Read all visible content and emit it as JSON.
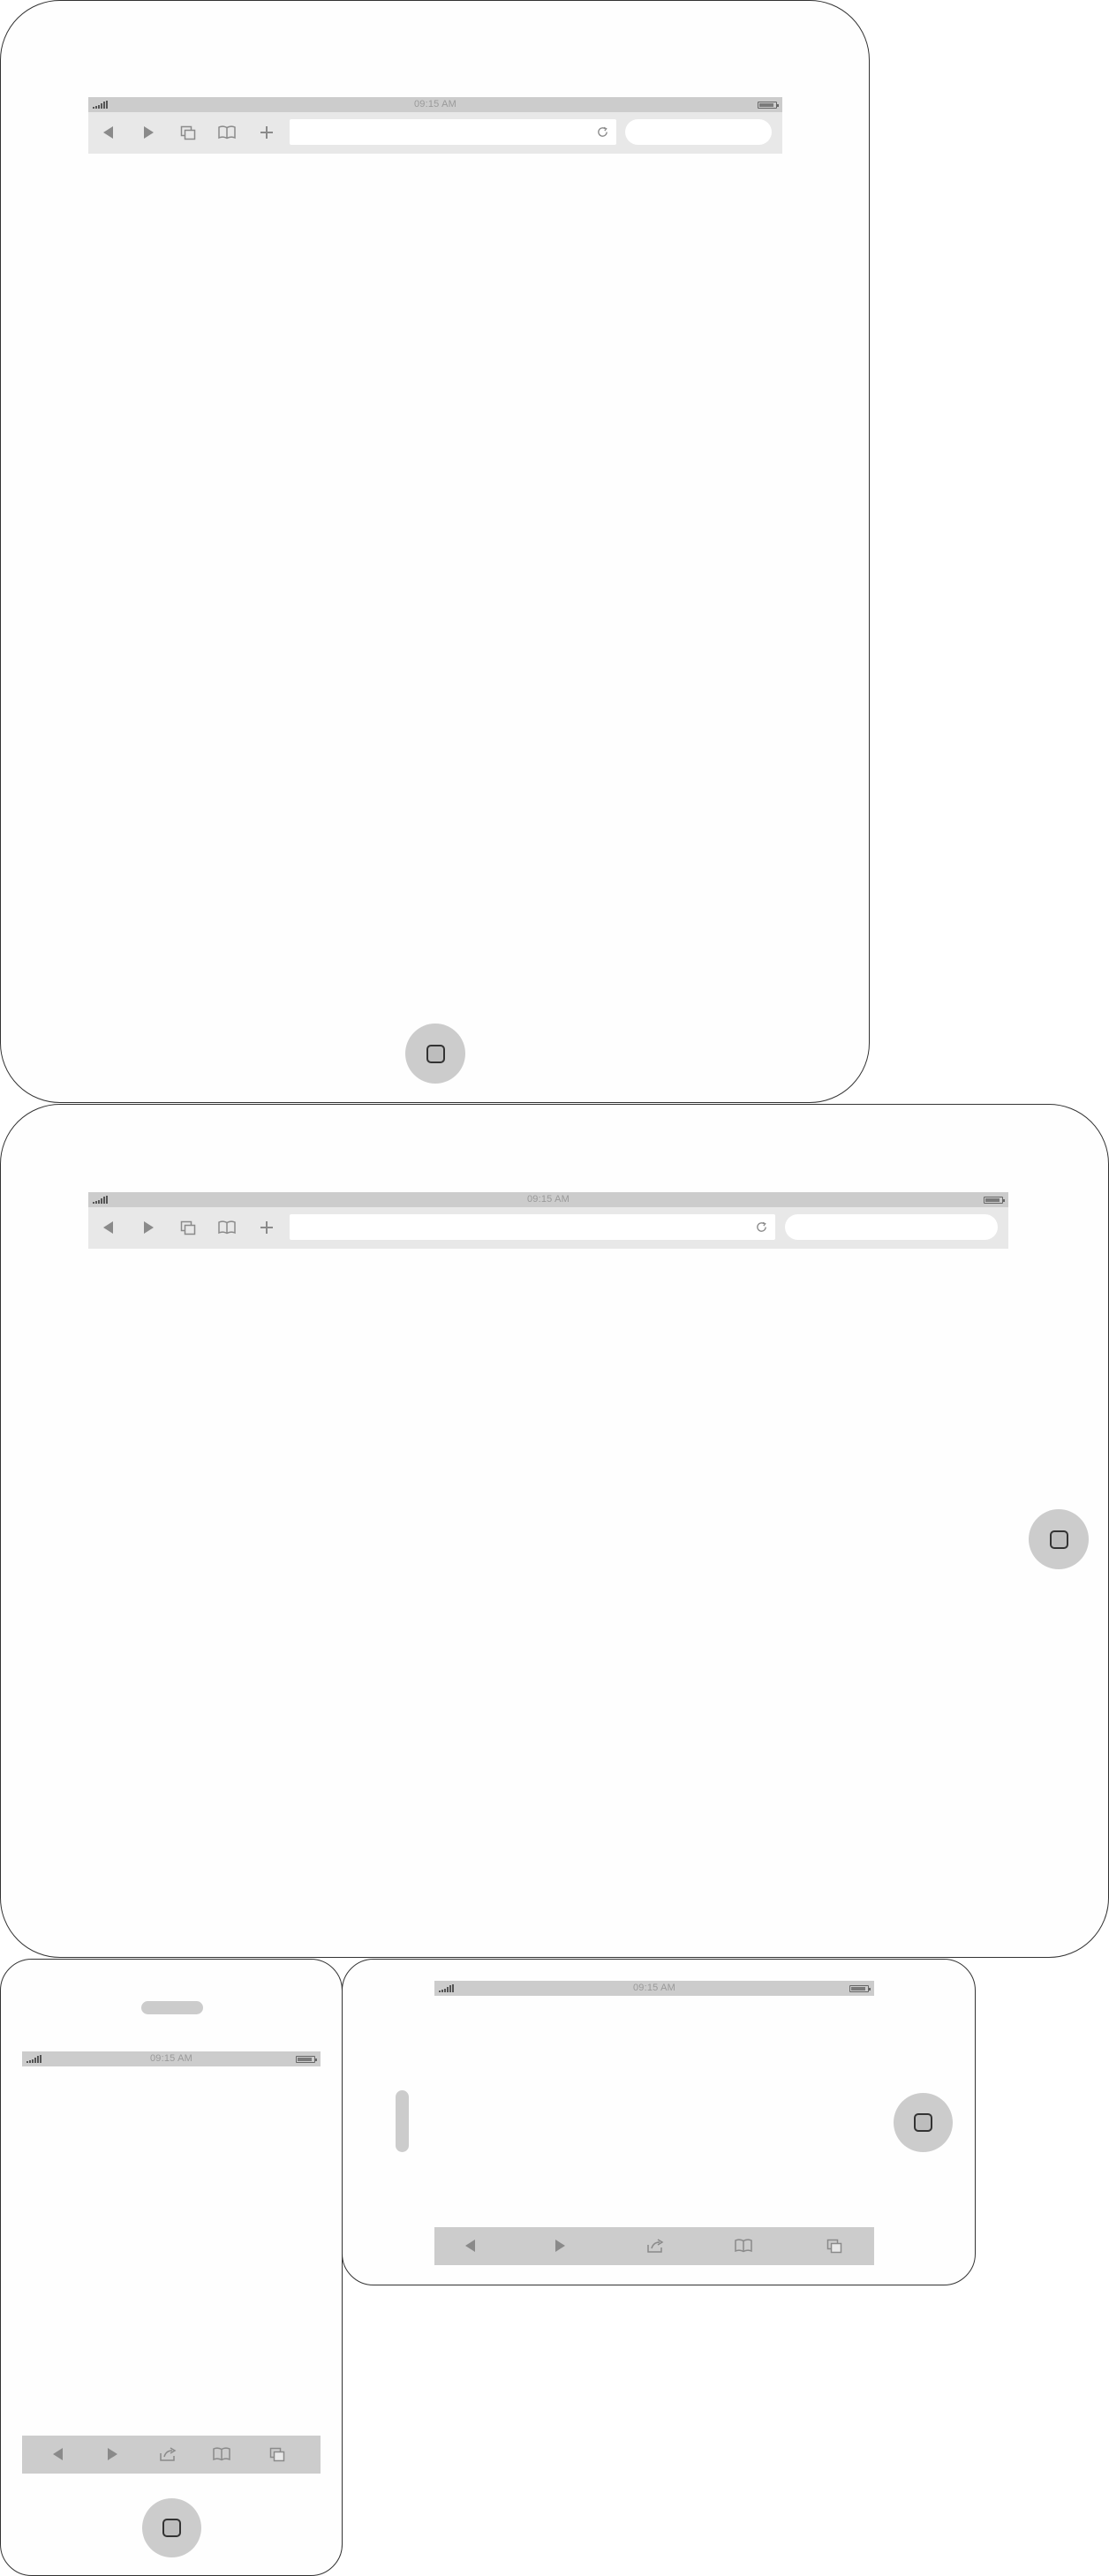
{
  "status": {
    "time": "09:15 AM"
  },
  "icons": {
    "back": "back-arrow-icon",
    "forward": "forward-arrow-icon",
    "pages": "pages-icon",
    "bookmarks": "bookmarks-book-icon",
    "add": "plus-icon",
    "share": "share-icon",
    "reload": "reload-icon",
    "home": "home-button-square-icon"
  },
  "browser": {
    "url_value": "",
    "search_value": ""
  },
  "colors": {
    "bezel_stroke": "#333333",
    "bar_gray": "#cccccc",
    "toolbar_light": "#e8e8e8",
    "icon_gray": "#8a8a8a"
  }
}
